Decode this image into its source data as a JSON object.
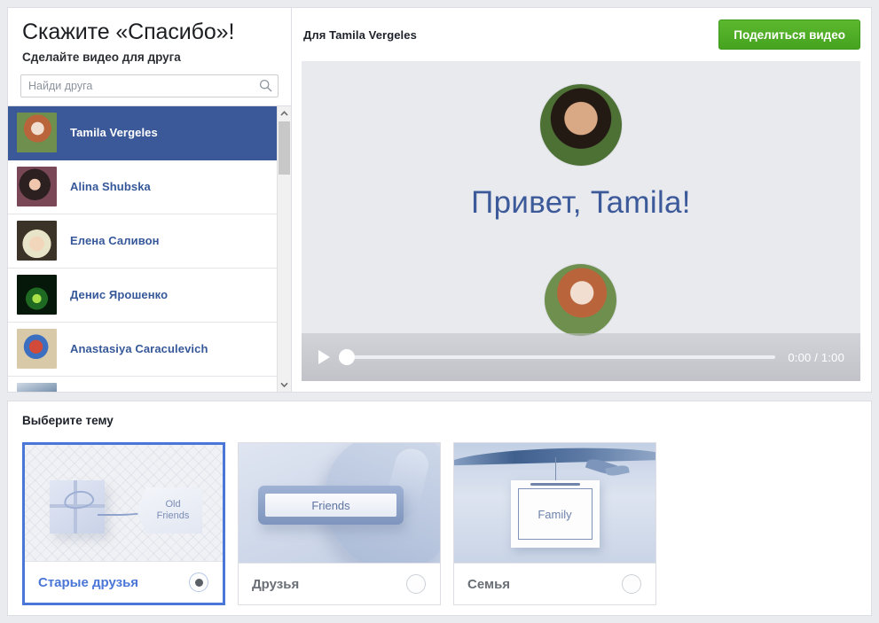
{
  "left_panel": {
    "headline": "Скажите «Спасибо»!",
    "subhead": "Сделайте видео для друга",
    "search_placeholder": "Найди друга",
    "search_value": "",
    "search_icon": "search-icon",
    "friends": [
      {
        "name": "Tamila Vergeles",
        "selected": true,
        "avatar_class": "av-tamila"
      },
      {
        "name": "Alina  Shubska",
        "selected": false,
        "avatar_class": "av-alina"
      },
      {
        "name": "Елена Саливон",
        "selected": false,
        "avatar_class": "av-elena"
      },
      {
        "name": "Денис Ярошенко",
        "selected": false,
        "avatar_class": "av-denis"
      },
      {
        "name": "Anastasiya Caraculevich",
        "selected": false,
        "avatar_class": "av-anast"
      },
      {
        "name": "",
        "selected": false,
        "avatar_class": "av-extra"
      }
    ],
    "scroll_up_icon": "chevron-up-icon",
    "scroll_down_icon": "chevron-down-icon"
  },
  "right_panel": {
    "for_label": "Для Tamila Vergeles",
    "share_button": "Поделиться видео",
    "greeting": "Привет, Tamila!",
    "player": {
      "play_icon": "play-icon",
      "time": "0:00 / 1:00",
      "progress_percent": 0
    },
    "top_avatar_class": "av-man",
    "bottom_avatar_class": "av-tamila"
  },
  "theme_section": {
    "title": "Выберите тему",
    "themes": [
      {
        "label": "Старые друзья",
        "thumb_text": "Old\nFriends",
        "thumb_line1": "Old",
        "thumb_line2": "Friends",
        "selected": true
      },
      {
        "label": "Друзья",
        "thumb_text": "Friends",
        "selected": false
      },
      {
        "label": "Семья",
        "thumb_text": "Family",
        "selected": false
      }
    ]
  },
  "colors": {
    "brand_blue": "#3b5998",
    "link_blue": "#365899",
    "accent_blue": "#4a76d8",
    "share_green": "#4caf27",
    "page_bg": "#e9ebee",
    "video_bg": "#e9eaee",
    "greeting_color": "#3c5a9a"
  }
}
